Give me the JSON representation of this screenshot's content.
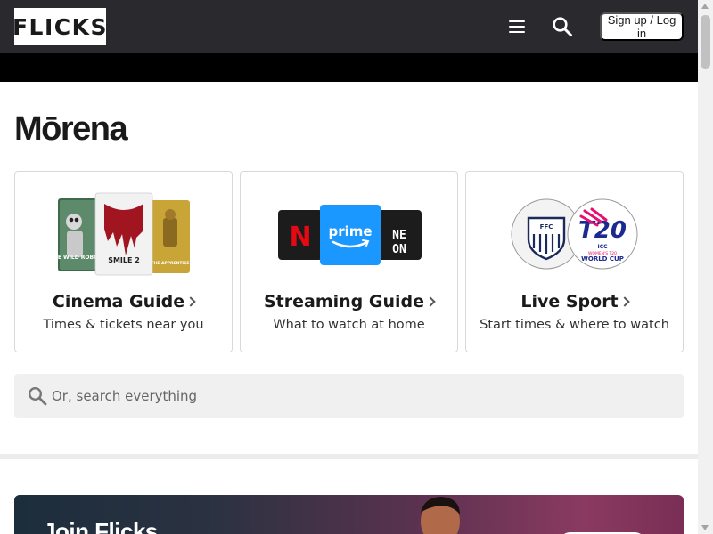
{
  "header": {
    "logo_text": "FLICKS",
    "signup_label": "Sign up / Log in",
    "menu_icon": "hamburger-menu-icon",
    "search_icon": "search-icon"
  },
  "page": {
    "title": "Mōrena"
  },
  "cards": [
    {
      "title": "Cinema Guide",
      "subtitle": "Times & tickets near you",
      "posters": [
        "THE WILD ROBOT",
        "SMILE 2",
        "THE APPRENTICE"
      ]
    },
    {
      "title": "Streaming Guide",
      "subtitle": "What to watch at home",
      "services": [
        "N",
        "prime",
        "NE ON"
      ]
    },
    {
      "title": "Live Sport",
      "subtitle": "Start times & where to watch",
      "badges": [
        "FFC",
        "T20",
        "ICC",
        "WOMEN'S T20",
        "WORLD CUP"
      ]
    }
  ],
  "search": {
    "placeholder": "Or, search everything"
  },
  "promo": {
    "title": "Join Flicks"
  },
  "colors": {
    "header_bg": "#2a2a2e",
    "prime_blue": "#1a98ff",
    "netflix_red": "#e50914",
    "t20_pink": "#e8106e",
    "t20_navy": "#1b2a8f"
  }
}
